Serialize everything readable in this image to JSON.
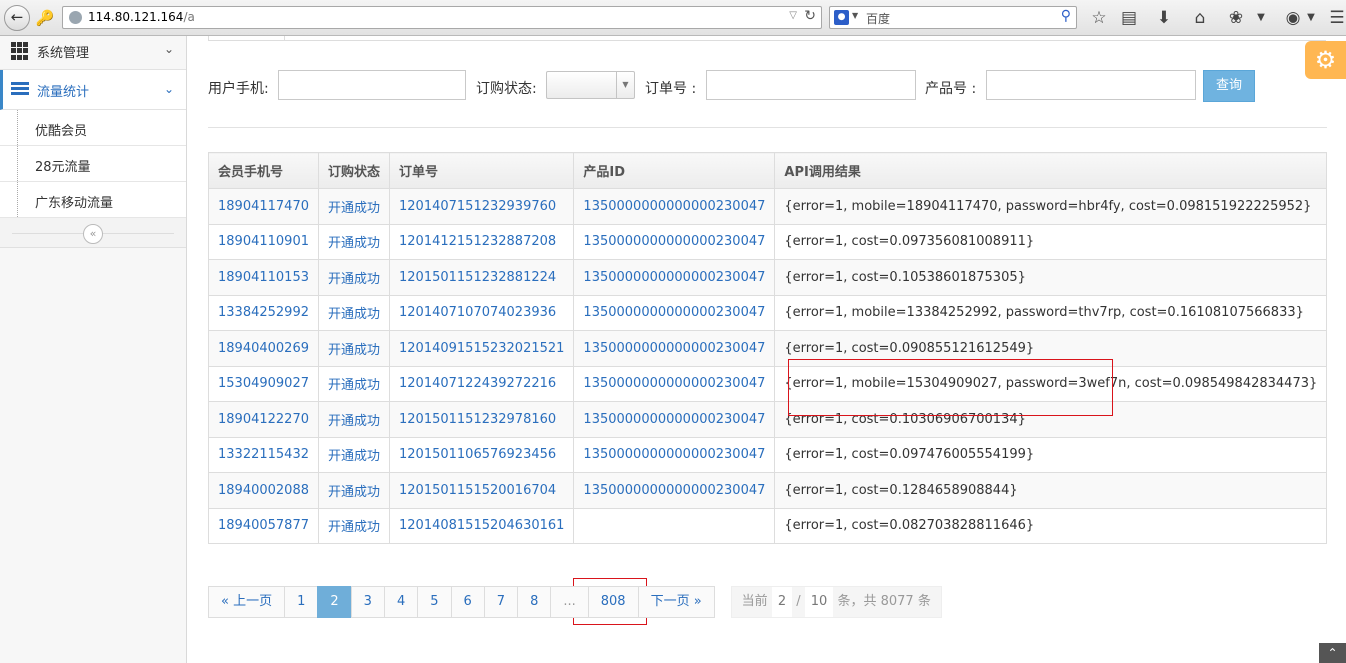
{
  "browser": {
    "url_host": "114.80.121.164",
    "url_path": "/a",
    "search_placeholder": "百度"
  },
  "sidebar": {
    "menus": [
      {
        "label": "系统管理",
        "icon": "grid-icon"
      },
      {
        "label": "流量统计",
        "icon": "bars-icon"
      }
    ],
    "sub_items": [
      {
        "label": "优酷会员"
      },
      {
        "label": "28元流量"
      },
      {
        "label": "广东移动流量"
      }
    ],
    "collapse_glyph": "«"
  },
  "filters": {
    "phone_label": "用户手机:",
    "status_label": "订购状态:",
    "order_label": "订单号 :",
    "product_label": "产品号 :",
    "query_button": "查询"
  },
  "table": {
    "headers": [
      "会员手机号",
      "订购状态",
      "订单号",
      "产品ID",
      "API调用结果"
    ],
    "rows": [
      [
        "18904117470",
        "开通成功",
        "1201407151232939760",
        "1350000000000000230047",
        "{error=1, mobile=18904117470, password=hbr4fy, cost=0.098151922225952}"
      ],
      [
        "18904110901",
        "开通成功",
        "1201412151232887208",
        "1350000000000000230047",
        "{error=1, cost=0.097356081008911}"
      ],
      [
        "18904110153",
        "开通成功",
        "1201501151232881224",
        "1350000000000000230047",
        "{error=1, cost=0.10538601875305}"
      ],
      [
        "13384252992",
        "开通成功",
        "1201407107074023936",
        "1350000000000000230047",
        "{error=1, mobile=13384252992, password=thv7rp, cost=0.16108107566833}"
      ],
      [
        "18940400269",
        "开通成功",
        "12014091515232021521",
        "1350000000000000230047",
        "{error=1, cost=0.090855121612549}"
      ],
      [
        "15304909027",
        "开通成功",
        "1201407122439272216",
        "1350000000000000230047",
        "{error=1, mobile=15304909027, password=3wef7n, cost=0.098549842834473}"
      ],
      [
        "18904122270",
        "开通成功",
        "1201501151232978160",
        "1350000000000000230047",
        "{error=1, cost=0.10306906700134}"
      ],
      [
        "13322115432",
        "开通成功",
        "1201501106576923456",
        "1350000000000000230047",
        "{error=1, cost=0.097476005554199}"
      ],
      [
        "18940002088",
        "开通成功",
        "1201501151520016704",
        "1350000000000000230047",
        "{error=1, cost=0.1284658908844}"
      ],
      [
        "18940057877",
        "开通成功",
        "12014081515204630161",
        "",
        "{error=1, cost=0.082703828811646}"
      ]
    ]
  },
  "pagination": {
    "prev": "« 上一页",
    "pages": [
      "1",
      "2",
      "3",
      "4",
      "5",
      "6",
      "7",
      "8",
      "...",
      "808"
    ],
    "current": "2",
    "next": "下一页 »",
    "info_prefix": "当前",
    "current_page": "2",
    "separator": "/",
    "total_pages": "10",
    "info_suffix": "条，共 8077 条"
  },
  "colors": {
    "accent": "#2a6ebd",
    "query_button": "#6fb3e0",
    "settings": "#ffb752",
    "highlight": "#d9141b"
  }
}
